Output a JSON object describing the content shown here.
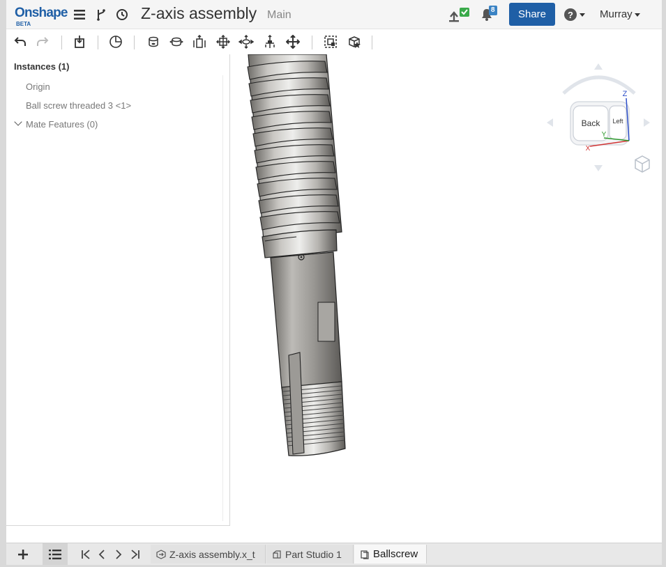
{
  "header": {
    "logo_text": "Onshape",
    "logo_sub": "BETA",
    "document_title": "Z-axis assembly",
    "branch": "Main",
    "notifications_count": "8",
    "share_label": "Share",
    "user_name": "Murray",
    "icons": [
      "hamburger-menu-icon",
      "version-graph-icon",
      "history-icon",
      "upload-check-icon",
      "bell-icon",
      "help-icon"
    ]
  },
  "toolbar": {
    "icons": [
      "undo-icon",
      "redo-icon",
      "insert-part-icon",
      "display-states-icon",
      "fastened-mate-icon",
      "revolute-mate-icon",
      "slider-mate-icon",
      "planar-mate-icon",
      "cylindrical-mate-icon",
      "pin-slot-mate-icon",
      "ball-mate-icon",
      "mate-connector-icon",
      "replicate-icon"
    ]
  },
  "panel": {
    "title": "Instances (1)",
    "items": [
      {
        "label": "Origin"
      },
      {
        "label": "Ball screw threaded 3 <1>"
      },
      {
        "label": "Mate Features (0)"
      }
    ]
  },
  "viewcube": {
    "face_front": "Back",
    "face_side": "Left",
    "axis_z": "Z",
    "axis_y": "Y",
    "axis_x": "X",
    "axis_z_color": "#2d4fc9",
    "axis_y_color": "#2e9a2e",
    "axis_x_color": "#d03232"
  },
  "tabs": [
    {
      "label": "Z-axis assembly.x_t",
      "icon": "imported-file-icon",
      "active": false
    },
    {
      "label": "Part Studio 1",
      "icon": "part-studio-icon",
      "active": false
    },
    {
      "label": "Ballscrew",
      "icon": "assembly-icon",
      "active": true
    }
  ],
  "colors": {
    "brand": "#1f5fa6",
    "badge": "#3b83c4"
  }
}
